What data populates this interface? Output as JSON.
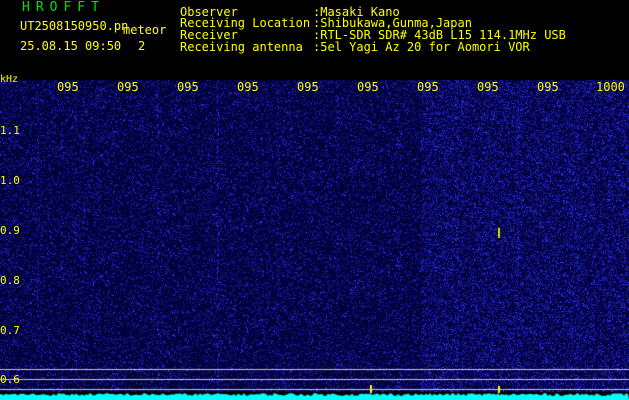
{
  "app_title": "HROFFT",
  "file_name": "UT2508150950.pn",
  "meteor_label": "meteor",
  "datetime": "25.08.15 09:50",
  "count": "2",
  "info": [
    {
      "label": "Observer",
      "value": ":Masaki Kano"
    },
    {
      "label": "Receiving Location",
      "value": ":Shibukawa,Gunma,Japan"
    },
    {
      "label": "Receiver",
      "value": ":RTL-SDR SDR# 43dB L15 114.1MHz USB"
    },
    {
      "label": "Receiving antenna",
      "value": ":5el Yagi Az 20 for Aomori VOR"
    }
  ],
  "time_ticks": [
    "095",
    "095",
    "095",
    "095",
    "095",
    "095",
    "095",
    "095",
    "095",
    "1000"
  ],
  "freq_unit": "kHz",
  "freq_ticks": [
    "1.1",
    "1.0",
    "0.9",
    "0.8",
    "0.7",
    "0.6"
  ],
  "colors": {
    "text": "#ffff00",
    "title": "#00e000",
    "noise": "#1a1acc",
    "trace": "#00ffff",
    "line": "#c8c8c8"
  }
}
